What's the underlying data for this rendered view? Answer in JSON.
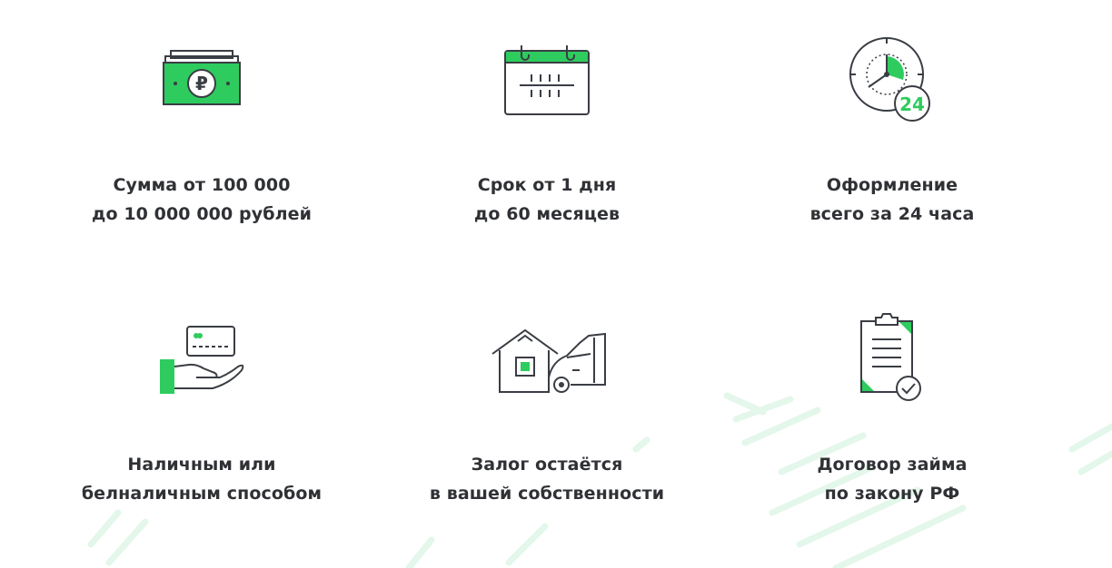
{
  "colors": {
    "accent": "#2ecc5e",
    "stroke": "#3a3d44",
    "text": "#2f3135",
    "deco": "#dff6e6"
  },
  "features": [
    {
      "icon": "ruble-banknote-icon",
      "line1": "Сумма от 100 000",
      "line2": "до 10 000 000 рублей"
    },
    {
      "icon": "calendar-icon",
      "line1": "Срок от 1 дня",
      "line2": "до 60 месяцев"
    },
    {
      "icon": "clock-24-icon",
      "badge": "24",
      "line1": "Оформление",
      "line2": "всего за 24 часа"
    },
    {
      "icon": "card-in-hand-icon",
      "line1": "Наличным или",
      "line2": "белналичным способом"
    },
    {
      "icon": "house-and-car-icon",
      "line1": "Залог остаётся",
      "line2": "в вашей собственности"
    },
    {
      "icon": "contract-checked-icon",
      "line1": "Договор займа",
      "line2": "по закону РФ"
    }
  ]
}
